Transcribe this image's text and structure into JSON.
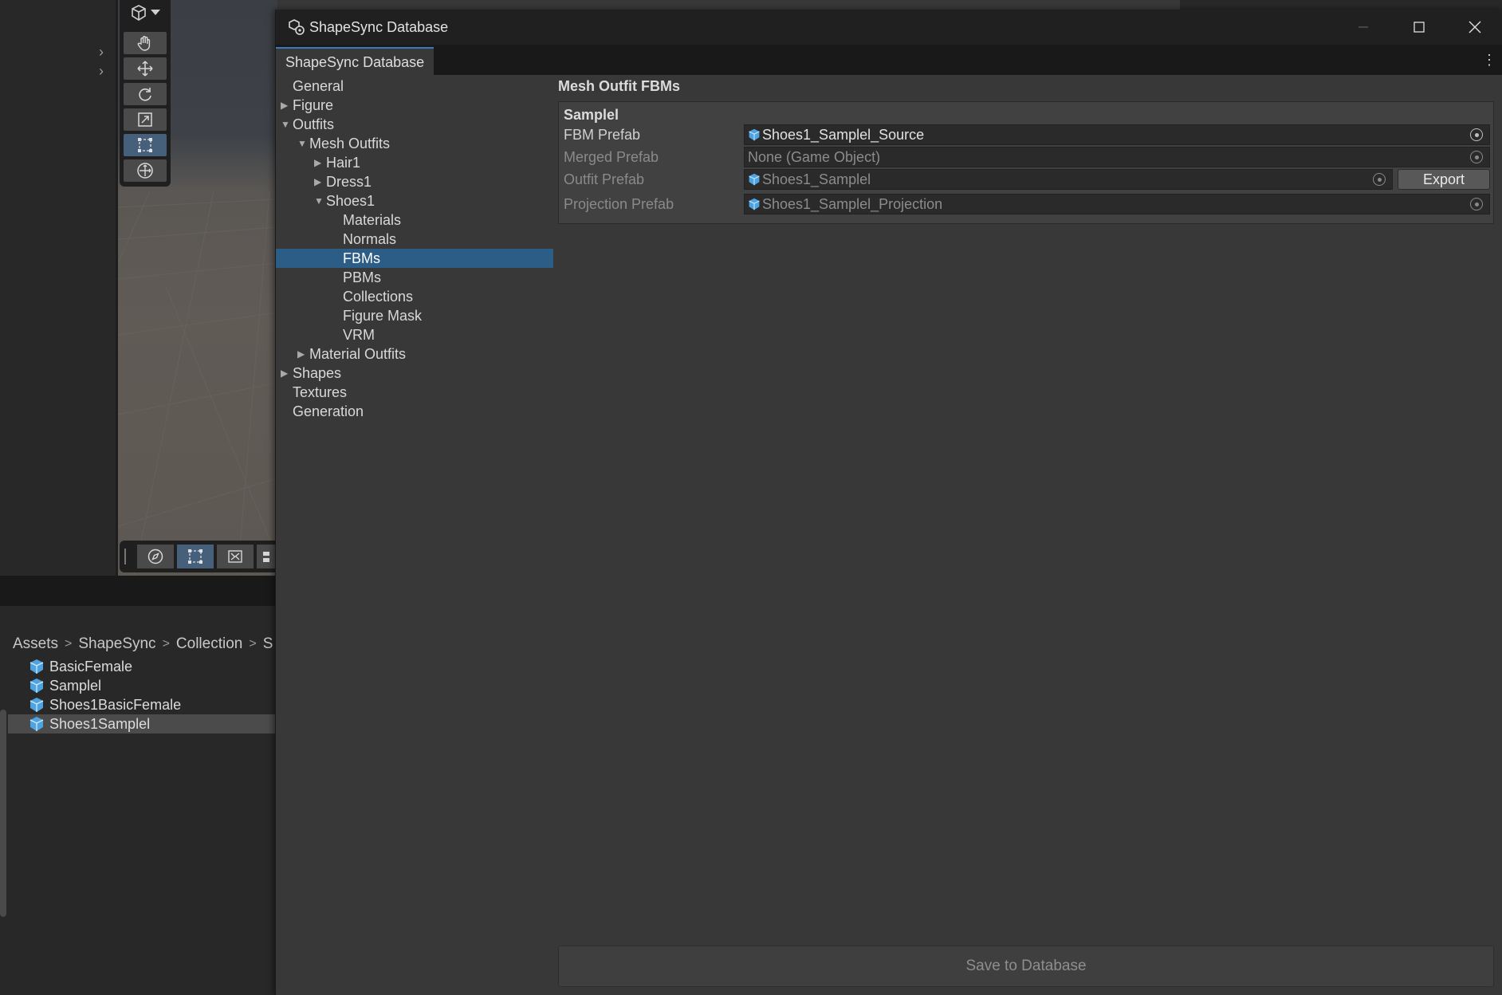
{
  "window": {
    "title": "ShapeSync Database",
    "tab_label": "ShapeSync Database",
    "controls": [
      "minimize",
      "maximize",
      "close"
    ]
  },
  "tree": {
    "items": [
      {
        "label": "General",
        "depth": 0,
        "expander": "none",
        "selected": false
      },
      {
        "label": "Figure",
        "depth": 0,
        "expander": "collapsed",
        "selected": false
      },
      {
        "label": "Outfits",
        "depth": 0,
        "expander": "expanded",
        "selected": false
      },
      {
        "label": "Mesh Outfits",
        "depth": 1,
        "expander": "expanded",
        "selected": false
      },
      {
        "label": "Hair1",
        "depth": 2,
        "expander": "collapsed",
        "selected": false
      },
      {
        "label": "Dress1",
        "depth": 2,
        "expander": "collapsed",
        "selected": false
      },
      {
        "label": "Shoes1",
        "depth": 2,
        "expander": "expanded",
        "selected": false
      },
      {
        "label": "Materials",
        "depth": 3,
        "expander": "none",
        "selected": false
      },
      {
        "label": "Normals",
        "depth": 3,
        "expander": "none",
        "selected": false
      },
      {
        "label": "FBMs",
        "depth": 3,
        "expander": "none",
        "selected": true
      },
      {
        "label": "PBMs",
        "depth": 3,
        "expander": "none",
        "selected": false
      },
      {
        "label": "Collections",
        "depth": 3,
        "expander": "none",
        "selected": false
      },
      {
        "label": "Figure Mask",
        "depth": 3,
        "expander": "none",
        "selected": false
      },
      {
        "label": "VRM",
        "depth": 3,
        "expander": "none",
        "selected": false
      },
      {
        "label": "Material Outfits",
        "depth": 1,
        "expander": "collapsed",
        "selected": false
      },
      {
        "label": "Shapes",
        "depth": 0,
        "expander": "collapsed",
        "selected": false
      },
      {
        "label": "Textures",
        "depth": 0,
        "expander": "none",
        "selected": false
      },
      {
        "label": "Generation",
        "depth": 0,
        "expander": "none",
        "selected": false
      }
    ]
  },
  "content": {
    "section_title": "Mesh Outfit FBMs",
    "entry_name": "Samplel",
    "fields": {
      "fbm_prefab": {
        "label": "FBM Prefab",
        "value": "Shoes1_Samplel_Source",
        "enabled": true
      },
      "merged_prefab": {
        "label": "Merged Prefab",
        "value": "None (Game Object)",
        "enabled": false
      },
      "outfit_prefab": {
        "label": "Outfit Prefab",
        "value": "Shoes1_Samplel",
        "enabled": false
      },
      "projection_prefab": {
        "label": "Projection Prefab",
        "value": "Shoes1_Samplel_Projection",
        "enabled": false
      }
    },
    "export_label": "Export",
    "save_label": "Save to Database"
  },
  "project": {
    "breadcrumb": [
      "Assets",
      "ShapeSync",
      "Collection",
      "S"
    ],
    "assets": [
      {
        "name": "BasicFemale",
        "selected": false
      },
      {
        "name": "Samplel",
        "selected": false
      },
      {
        "name": "Shoes1BasicFemale",
        "selected": false
      },
      {
        "name": "Shoes1Samplel",
        "selected": true
      }
    ]
  },
  "scene_tools": {
    "palette": [
      "hand-tool",
      "move-tool",
      "rotate-tool",
      "scale-tool",
      "rect-tool",
      "transform-tool"
    ],
    "active_palette_tool": "rect-tool",
    "overlay": [
      "orientation-tool",
      "rect-overlay",
      "snap-overlay",
      "more-overlay"
    ]
  },
  "colors": {
    "selection": "#2c5d87",
    "accent": "#3a79bb",
    "prefab_icon": "#4fa3e0"
  }
}
